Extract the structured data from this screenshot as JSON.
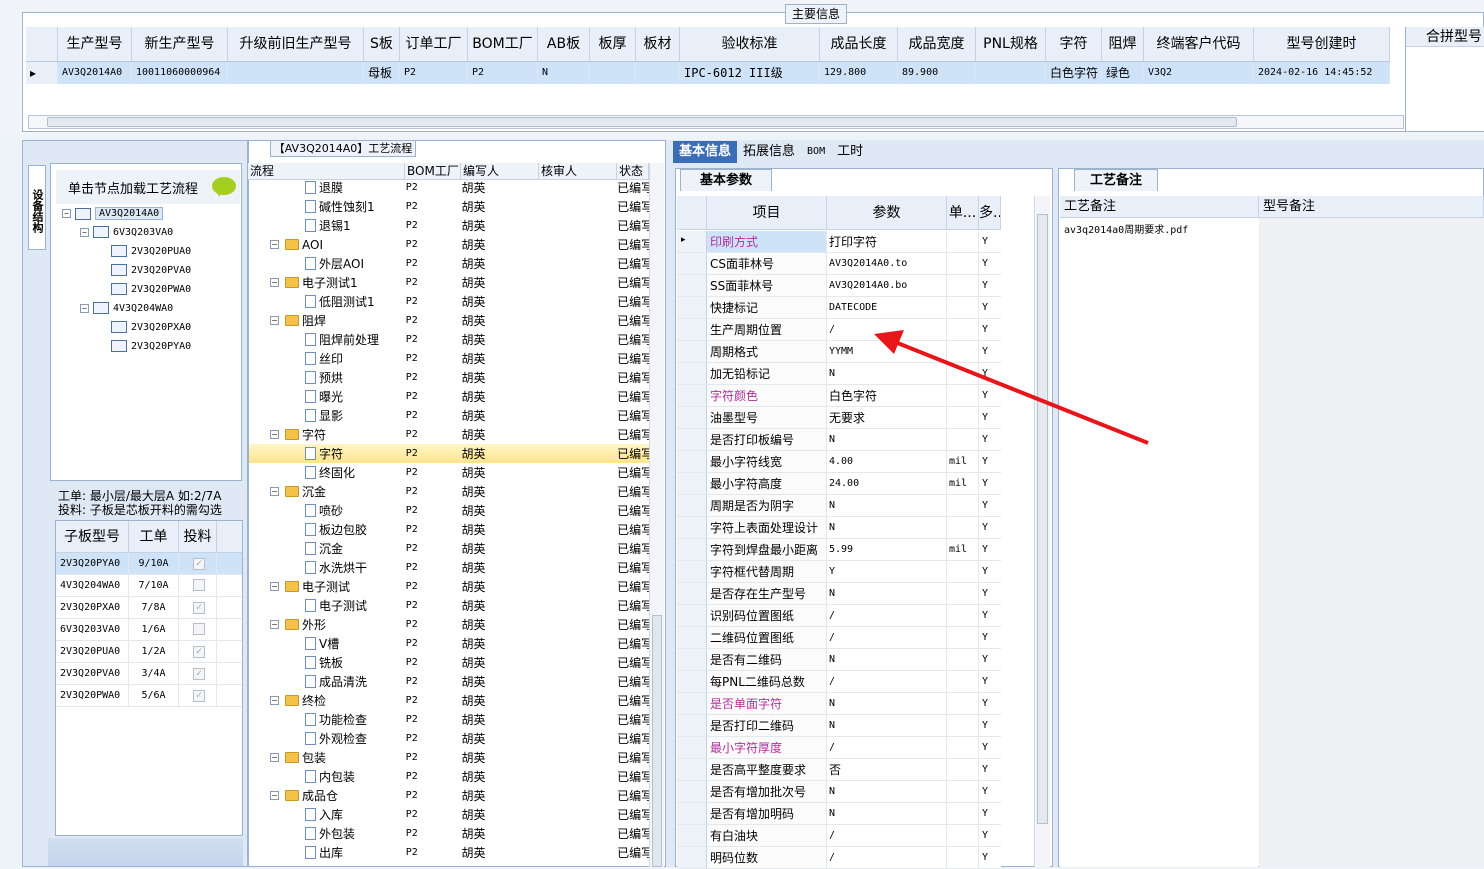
{
  "main_info": {
    "title": "主要信息",
    "columns": [
      "生产型号",
      "新生产型号",
      "升级前旧生产型号",
      "S板",
      "订单工厂",
      "BOM工厂",
      "AB板",
      "板厚",
      "板材",
      "验收标准",
      "成品长度",
      "成品宽度",
      "PNL规格",
      "字符",
      "阻焊",
      "终端客户代码",
      "型号创建时"
    ],
    "row": [
      "AV3Q2014A0",
      "10011060000964",
      "",
      "母板",
      "P2",
      "P2",
      "N",
      "",
      "",
      "IPC-6012 III级",
      "129.800",
      "89.900",
      "",
      "白色字符",
      "绿色",
      "V3Q2",
      "2024-02-16 14:45:52"
    ],
    "merge_column": "合拼型号"
  },
  "left_panel": {
    "vertical_tab": "设备结构",
    "load_hint": "单击节点加载工艺流程",
    "tree": [
      {
        "label": "AV3Q2014A0",
        "level": 0
      },
      {
        "label": "6V3Q203VA0",
        "level": 1
      },
      {
        "label": "2V3Q20PUA0",
        "level": 2
      },
      {
        "label": "2V3Q20PVA0",
        "level": 2
      },
      {
        "label": "2V3Q20PWA0",
        "level": 2
      },
      {
        "label": "4V3Q204WA0",
        "level": 1
      },
      {
        "label": "2V3Q20PXA0",
        "level": 2
      },
      {
        "label": "2V3Q20PYA0",
        "level": 2
      }
    ],
    "note_line1": "工单: 最小层/最大层A 如:2/7A",
    "note_line2": "投料: 子板是芯板开料的需勾选",
    "sub_table": {
      "headers": [
        "子板型号",
        "工单",
        "投料"
      ],
      "rows": [
        {
          "model": "2V3Q20PYA0",
          "order": "9/10A",
          "checked": true
        },
        {
          "model": "4V3Q204WA0",
          "order": "7/10A",
          "checked": false
        },
        {
          "model": "2V3Q20PXA0",
          "order": "7/8A",
          "checked": true
        },
        {
          "model": "6V3Q203VA0",
          "order": "1/6A",
          "checked": false
        },
        {
          "model": "2V3Q20PUA0",
          "order": "1/2A",
          "checked": true
        },
        {
          "model": "2V3Q20PVA0",
          "order": "3/4A",
          "checked": true
        },
        {
          "model": "2V3Q20PWA0",
          "order": "5/6A",
          "checked": true
        }
      ]
    }
  },
  "flow_panel": {
    "title": "【AV3Q2014A0】工艺流程",
    "headers": [
      "流程",
      "BOM工厂",
      "编写人",
      "核审人",
      "状态"
    ],
    "rows": [
      {
        "name": "退膜",
        "type": "doc",
        "bom": "P2",
        "writer": "胡英",
        "status": "已编写"
      },
      {
        "name": "碱性蚀刻1",
        "type": "doc",
        "bom": "P2",
        "writer": "胡英",
        "status": "已编写"
      },
      {
        "name": "退锡1",
        "type": "doc",
        "bom": "P2",
        "writer": "胡英",
        "status": "已编写"
      },
      {
        "name": "AOI",
        "type": "folder",
        "bom": "P2",
        "writer": "胡英",
        "status": "已编写"
      },
      {
        "name": "外层AOI",
        "type": "doc",
        "bom": "P2",
        "writer": "胡英",
        "status": "已编写"
      },
      {
        "name": "电子测试1",
        "type": "folder",
        "bom": "P2",
        "writer": "胡英",
        "status": "已编写"
      },
      {
        "name": "低阻测试1",
        "type": "doc",
        "bom": "P2",
        "writer": "胡英",
        "status": "已编写"
      },
      {
        "name": "阻焊",
        "type": "folder",
        "bom": "P2",
        "writer": "胡英",
        "status": "已编写"
      },
      {
        "name": "阻焊前处理",
        "type": "doc",
        "bom": "P2",
        "writer": "胡英",
        "status": "已编写"
      },
      {
        "name": "丝印",
        "type": "doc",
        "bom": "P2",
        "writer": "胡英",
        "status": "已编写"
      },
      {
        "name": "预烘",
        "type": "doc",
        "bom": "P2",
        "writer": "胡英",
        "status": "已编写"
      },
      {
        "name": "曝光",
        "type": "doc",
        "bom": "P2",
        "writer": "胡英",
        "status": "已编写"
      },
      {
        "name": "显影",
        "type": "doc",
        "bom": "P2",
        "writer": "胡英",
        "status": "已编写"
      },
      {
        "name": "字符",
        "type": "folder",
        "bom": "P2",
        "writer": "胡英",
        "status": "已编写"
      },
      {
        "name": "字符",
        "type": "doc",
        "bom": "P2",
        "writer": "胡英",
        "status": "已编写",
        "selected": true
      },
      {
        "name": "终固化",
        "type": "doc",
        "bom": "P2",
        "writer": "胡英",
        "status": "已编写"
      },
      {
        "name": "沉金",
        "type": "folder",
        "bom": "P2",
        "writer": "胡英",
        "status": "已编写"
      },
      {
        "name": "喷砂",
        "type": "doc",
        "bom": "P2",
        "writer": "胡英",
        "status": "已编写"
      },
      {
        "name": "板边包胶",
        "type": "doc",
        "bom": "P2",
        "writer": "胡英",
        "status": "已编写"
      },
      {
        "name": "沉金",
        "type": "doc",
        "bom": "P2",
        "writer": "胡英",
        "status": "已编写"
      },
      {
        "name": "水洗烘干",
        "type": "doc",
        "bom": "P2",
        "writer": "胡英",
        "status": "已编写"
      },
      {
        "name": "电子测试",
        "type": "folder",
        "bom": "P2",
        "writer": "胡英",
        "status": "已编写"
      },
      {
        "name": "电子测试",
        "type": "doc",
        "bom": "P2",
        "writer": "胡英",
        "status": "已编写"
      },
      {
        "name": "外形",
        "type": "folder",
        "bom": "P2",
        "writer": "胡英",
        "status": "已编写"
      },
      {
        "name": "V槽",
        "type": "doc",
        "bom": "P2",
        "writer": "胡英",
        "status": "已编写"
      },
      {
        "name": "铣板",
        "type": "doc",
        "bom": "P2",
        "writer": "胡英",
        "status": "已编写"
      },
      {
        "name": "成品清洗",
        "type": "doc",
        "bom": "P2",
        "writer": "胡英",
        "status": "已编写"
      },
      {
        "name": "终检",
        "type": "folder",
        "bom": "P2",
        "writer": "胡英",
        "status": "已编写"
      },
      {
        "name": "功能检查",
        "type": "doc",
        "bom": "P2",
        "writer": "胡英",
        "status": "已编写"
      },
      {
        "name": "外观检查",
        "type": "doc",
        "bom": "P2",
        "writer": "胡英",
        "status": "已编写"
      },
      {
        "name": "包装",
        "type": "folder",
        "bom": "P2",
        "writer": "胡英",
        "status": "已编写"
      },
      {
        "name": "内包装",
        "type": "doc",
        "bom": "P2",
        "writer": "胡英",
        "status": "已编写"
      },
      {
        "name": "成品仓",
        "type": "folder",
        "bom": "P2",
        "writer": "胡英",
        "status": "已编写"
      },
      {
        "name": "入库",
        "type": "doc",
        "bom": "P2",
        "writer": "胡英",
        "status": "已编写"
      },
      {
        "name": "外包装",
        "type": "doc",
        "bom": "P2",
        "writer": "胡英",
        "status": "已编写"
      },
      {
        "name": "出库",
        "type": "doc",
        "bom": "P2",
        "writer": "胡英",
        "status": "已编写"
      }
    ]
  },
  "right_panel": {
    "tabs": [
      "基本信息",
      "拓展信息",
      "BOM",
      "工时"
    ],
    "basic_tab": "基本参数",
    "param_headers": [
      "项目",
      "参数",
      "单...",
      "多..."
    ],
    "params": [
      {
        "k": "印刷方式",
        "v": "打印字符",
        "u": "",
        "y": "Y",
        "pink": true
      },
      {
        "k": "CS面菲林号",
        "v": "AV3Q2014A0.to",
        "u": "",
        "y": "Y"
      },
      {
        "k": "SS面菲林号",
        "v": "AV3Q2014A0.bo",
        "u": "",
        "y": "Y"
      },
      {
        "k": "快捷标记",
        "v": "DATECODE",
        "u": "",
        "y": "Y"
      },
      {
        "k": "生产周期位置",
        "v": "/",
        "u": "",
        "y": "Y"
      },
      {
        "k": "周期格式",
        "v": "YYMM",
        "u": "",
        "y": "Y"
      },
      {
        "k": "加无铅标记",
        "v": "N",
        "u": "",
        "y": "Y"
      },
      {
        "k": "字符颜色",
        "v": "白色字符",
        "u": "",
        "y": "Y",
        "pink": true
      },
      {
        "k": "油墨型号",
        "v": "无要求",
        "u": "",
        "y": "Y"
      },
      {
        "k": "是否打印板编号",
        "v": "N",
        "u": "",
        "y": "Y"
      },
      {
        "k": "最小字符线宽",
        "v": "4.00",
        "u": "mil",
        "y": "Y"
      },
      {
        "k": "最小字符高度",
        "v": "24.00",
        "u": "mil",
        "y": "Y"
      },
      {
        "k": "周期是否为阴字",
        "v": "N",
        "u": "",
        "y": "Y"
      },
      {
        "k": "字符上表面处理设计",
        "v": "N",
        "u": "",
        "y": "Y"
      },
      {
        "k": "字符到焊盘最小距离",
        "v": "5.99",
        "u": "mil",
        "y": "Y"
      },
      {
        "k": "字符框代替周期",
        "v": "Y",
        "u": "",
        "y": "Y"
      },
      {
        "k": "是否存在生产型号",
        "v": "N",
        "u": "",
        "y": "Y"
      },
      {
        "k": "识别码位置图纸",
        "v": "/",
        "u": "",
        "y": "Y"
      },
      {
        "k": "二维码位置图纸",
        "v": "/",
        "u": "",
        "y": "Y"
      },
      {
        "k": "是否有二维码",
        "v": "N",
        "u": "",
        "y": "Y"
      },
      {
        "k": "每PNL二维码总数",
        "v": "/",
        "u": "",
        "y": "Y"
      },
      {
        "k": "是否单面字符",
        "v": "N",
        "u": "",
        "y": "Y",
        "pink": true
      },
      {
        "k": "是否打印二维码",
        "v": "N",
        "u": "",
        "y": "Y"
      },
      {
        "k": "最小字符厚度",
        "v": "/",
        "u": "",
        "y": "Y",
        "pink": true
      },
      {
        "k": "是否高平整度要求",
        "v": "否",
        "u": "",
        "y": "Y"
      },
      {
        "k": "是否有增加批次号",
        "v": "N",
        "u": "",
        "y": "Y"
      },
      {
        "k": "是否有增加明码",
        "v": "N",
        "u": "",
        "y": "Y"
      },
      {
        "k": "有白油块",
        "v": "/",
        "u": "",
        "y": "Y"
      },
      {
        "k": "明码位数",
        "v": "/",
        "u": "",
        "y": "Y"
      }
    ],
    "remark_tab": "工艺备注",
    "remark_headers": [
      "工艺备注",
      "型号备注"
    ],
    "remark_file": "av3q2014a0周期要求.pdf"
  },
  "colors": {
    "accent": "#3a6db5",
    "selected_row": "#cfe3f8",
    "highlight": "#ffe48a",
    "pink_key": "#b0309a",
    "arrow": "#e8151b"
  }
}
